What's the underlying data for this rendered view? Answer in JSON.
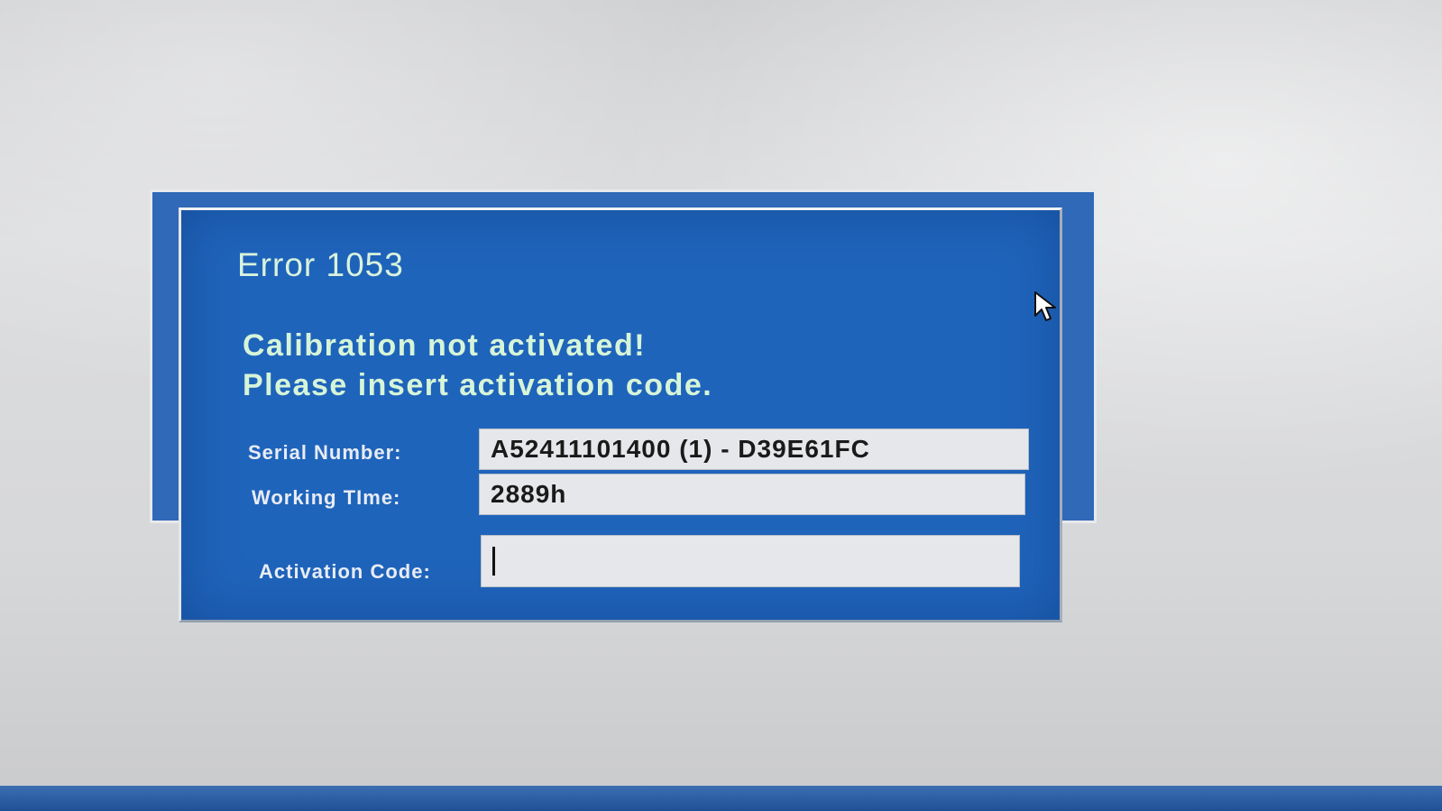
{
  "dialog": {
    "title": "Error 1053",
    "message_line1": "Calibration not activated!",
    "message_line2": "Please insert activation code.",
    "fields": {
      "serial_label": "Serial Number:",
      "serial_value": "A52411101400 (1) - D39E61FC",
      "working_time_label": "Working TIme:",
      "working_time_value": "2889h",
      "activation_label": "Activation Code:",
      "activation_value": ""
    }
  },
  "colors": {
    "dialog_background": "#1f64bb",
    "message_text": "#d6f5d8",
    "field_background": "#e6e7ea"
  },
  "icons": {
    "mouse_pointer": "mouse-pointer-icon"
  }
}
